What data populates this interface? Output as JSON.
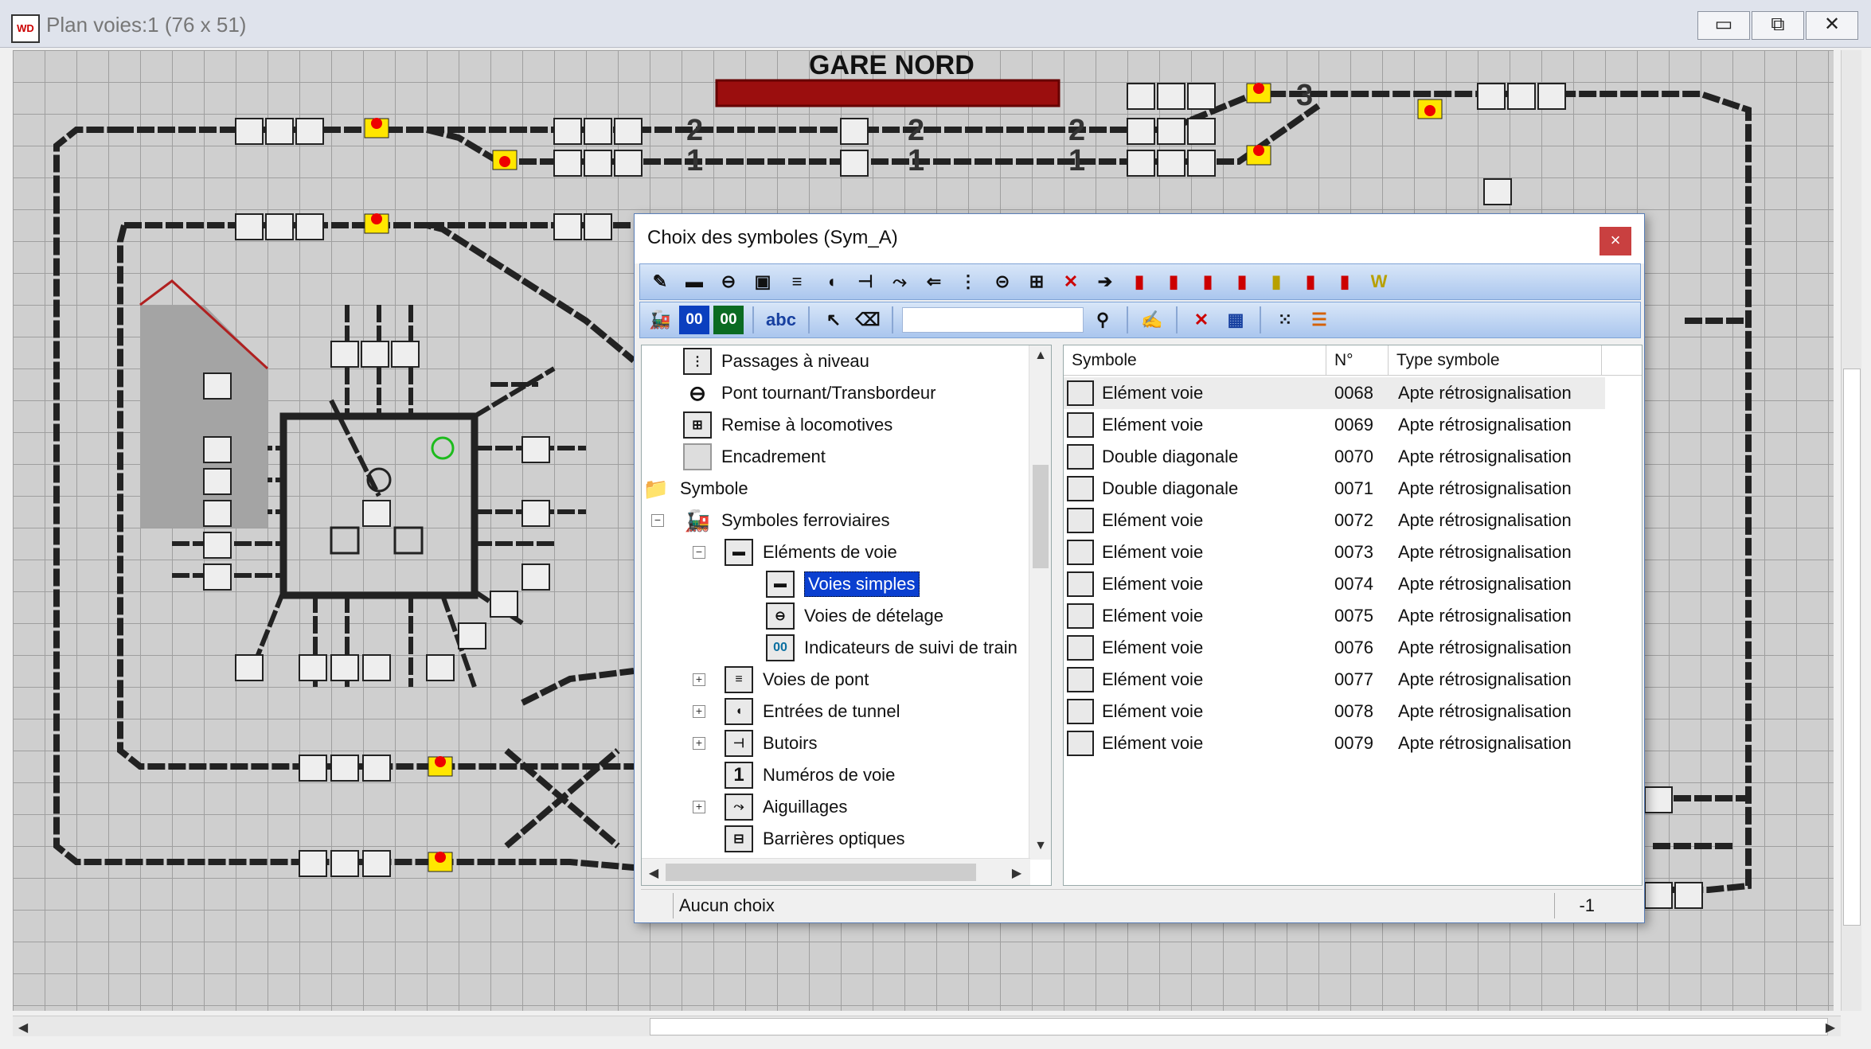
{
  "window": {
    "title": "Plan voies:1 (76 x 51)",
    "app_icon": "WD",
    "minimize": "▭",
    "maximize": "⧉",
    "close": "✕"
  },
  "plan": {
    "station_name": "GARE NORD",
    "track_numbers": [
      "2",
      "1",
      "2",
      "1",
      "2",
      "1",
      "3"
    ]
  },
  "dialog": {
    "title": "Choix des symboles (Sym_A)",
    "close": "×",
    "toolbar2": {
      "counter_a": "00",
      "counter_b": "00",
      "text_tool": "abc"
    },
    "tree": [
      {
        "label": "Passages à niveau",
        "icon": "level-crossing-icon"
      },
      {
        "label": "Pont tournant/Transbordeur",
        "icon": "turntable-icon"
      },
      {
        "label": "Remise à locomotives",
        "icon": "engine-shed-icon"
      },
      {
        "label": "Encadrement",
        "icon": "frame-icon"
      },
      {
        "label": "Symbole",
        "icon": "folder-icon"
      },
      {
        "label": "Symboles ferroviaires",
        "icon": "locomotive-icon"
      },
      {
        "label": "Eléments de voie",
        "icon": "track-element-icon"
      },
      {
        "label": "Voies simples",
        "icon": "simple-track-icon"
      },
      {
        "label": "Voies de dételage",
        "icon": "uncoupling-track-icon"
      },
      {
        "label": "Indicateurs de suivi de train",
        "icon": "train-tracking-icon"
      },
      {
        "label": "Voies de pont",
        "icon": "bridge-track-icon"
      },
      {
        "label": "Entrées de tunnel",
        "icon": "tunnel-entry-icon"
      },
      {
        "label": "Butoirs",
        "icon": "buffer-stop-icon"
      },
      {
        "label": "Numéros de voie",
        "icon": "track-number-icon"
      },
      {
        "label": "Aiguillages",
        "icon": "switch-icon"
      },
      {
        "label": "Barrières optiques",
        "icon": "light-barrier-icon"
      }
    ],
    "list": {
      "headers": [
        "Symbole",
        "N°",
        "Type symbole"
      ],
      "rows": [
        {
          "name": "Elément voie",
          "num": "0068",
          "type": "Apte rétrosignalisation"
        },
        {
          "name": "Elément voie",
          "num": "0069",
          "type": "Apte rétrosignalisation"
        },
        {
          "name": "Double diagonale",
          "num": "0070",
          "type": "Apte rétrosignalisation"
        },
        {
          "name": "Double diagonale",
          "num": "0071",
          "type": "Apte rétrosignalisation"
        },
        {
          "name": "Elément voie",
          "num": "0072",
          "type": "Apte rétrosignalisation"
        },
        {
          "name": "Elément voie",
          "num": "0073",
          "type": "Apte rétrosignalisation"
        },
        {
          "name": "Elément voie",
          "num": "0074",
          "type": "Apte rétrosignalisation"
        },
        {
          "name": "Elément voie",
          "num": "0075",
          "type": "Apte rétrosignalisation"
        },
        {
          "name": "Elément voie",
          "num": "0076",
          "type": "Apte rétrosignalisation"
        },
        {
          "name": "Elément voie",
          "num": "0077",
          "type": "Apte rétrosignalisation"
        },
        {
          "name": "Elément voie",
          "num": "0078",
          "type": "Apte rétrosignalisation"
        },
        {
          "name": "Elément voie",
          "num": "0079",
          "type": "Apte rétrosignalisation"
        }
      ]
    },
    "status": {
      "text": "Aucun choix",
      "value": "-1"
    }
  },
  "colors": {
    "track": "#222222",
    "signal_red": "#e00000",
    "signal_yellow": "#ffe600",
    "station_bar": "#9b0e0e",
    "selection": "#0a3fd0"
  }
}
